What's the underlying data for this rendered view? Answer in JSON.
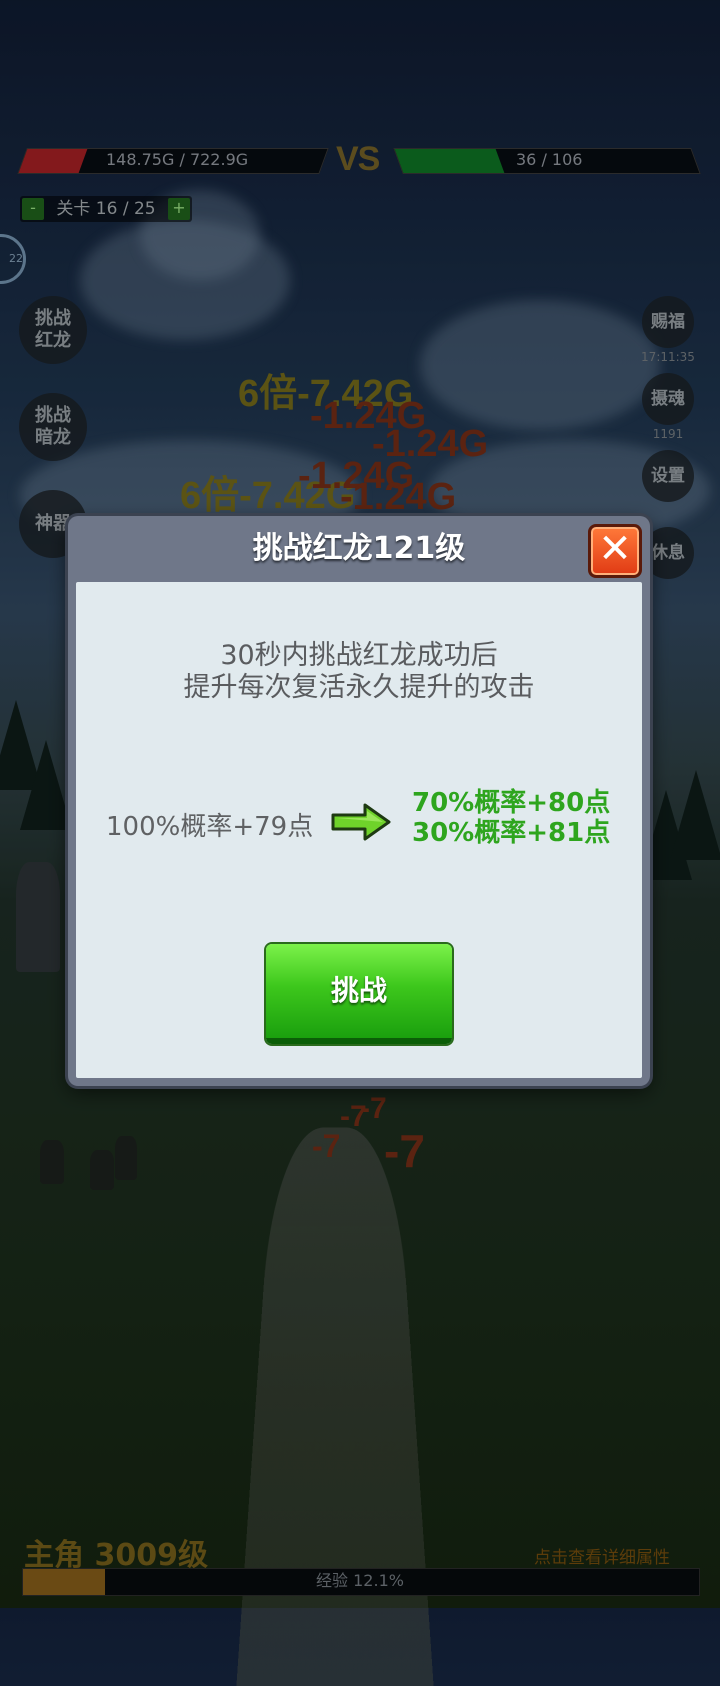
{
  "hud": {
    "player_hp_text": "148.75G / 722.9G",
    "player_hp_fraction": 0.2,
    "vs_label": "VS",
    "enemy_hp_text": "36 / 106",
    "enemy_hp_fraction": 0.34,
    "stage_minus": "-",
    "stage_label": "关卡 16 / 25",
    "stage_plus": "+",
    "ring_text": "22"
  },
  "left_buttons": [
    {
      "label": "挑战\n红龙"
    },
    {
      "label": "挑战\n暗龙"
    },
    {
      "label": "神器"
    }
  ],
  "right_buttons": {
    "bless": "赐福",
    "bless_time": "17:11:35",
    "soul": "摄魂",
    "soul_count": "1191",
    "settings": "设置",
    "rest": "休息"
  },
  "floating_numbers": [
    {
      "text": "6倍-7.42G",
      "color": "#6b6218"
    },
    {
      "text": "-1.24G",
      "color": "#6b2a14"
    },
    {
      "text": "-1.24G",
      "color": "#6b2a14"
    },
    {
      "text": "6倍-7.42G",
      "color": "#6b6218"
    },
    {
      "text": "-1.24G",
      "color": "#6b2a14"
    },
    {
      "text": "-1.24G",
      "color": "#6b2a14"
    },
    {
      "text": "-7",
      "color": "#6b2a14"
    },
    {
      "text": "-7",
      "color": "#6b2a14"
    },
    {
      "text": "-7",
      "color": "#6b2a14"
    },
    {
      "text": "-7",
      "color": "#6b2a14"
    }
  ],
  "dialog": {
    "title": "挑战红龙121级",
    "close_symbol": "✕",
    "desc_line1": "30秒内挑战红龙成功后",
    "desc_line2": "提升每次复活永久提升的攻击",
    "current": "100%概率+79点",
    "next_line1": "70%概率+80点",
    "next_line2": "30%概率+81点",
    "challenge_button": "挑战"
  },
  "footer": {
    "hero_level": "主角 3009级",
    "detail_link": "点击查看详细属性",
    "exp_text": "经验 12.1%",
    "exp_fraction": 0.121
  },
  "colors": {
    "accent_green": "#2ea51e",
    "close_red": "#e03a14",
    "hp_red": "#9a1e22",
    "hp_green": "#0e6b22"
  }
}
